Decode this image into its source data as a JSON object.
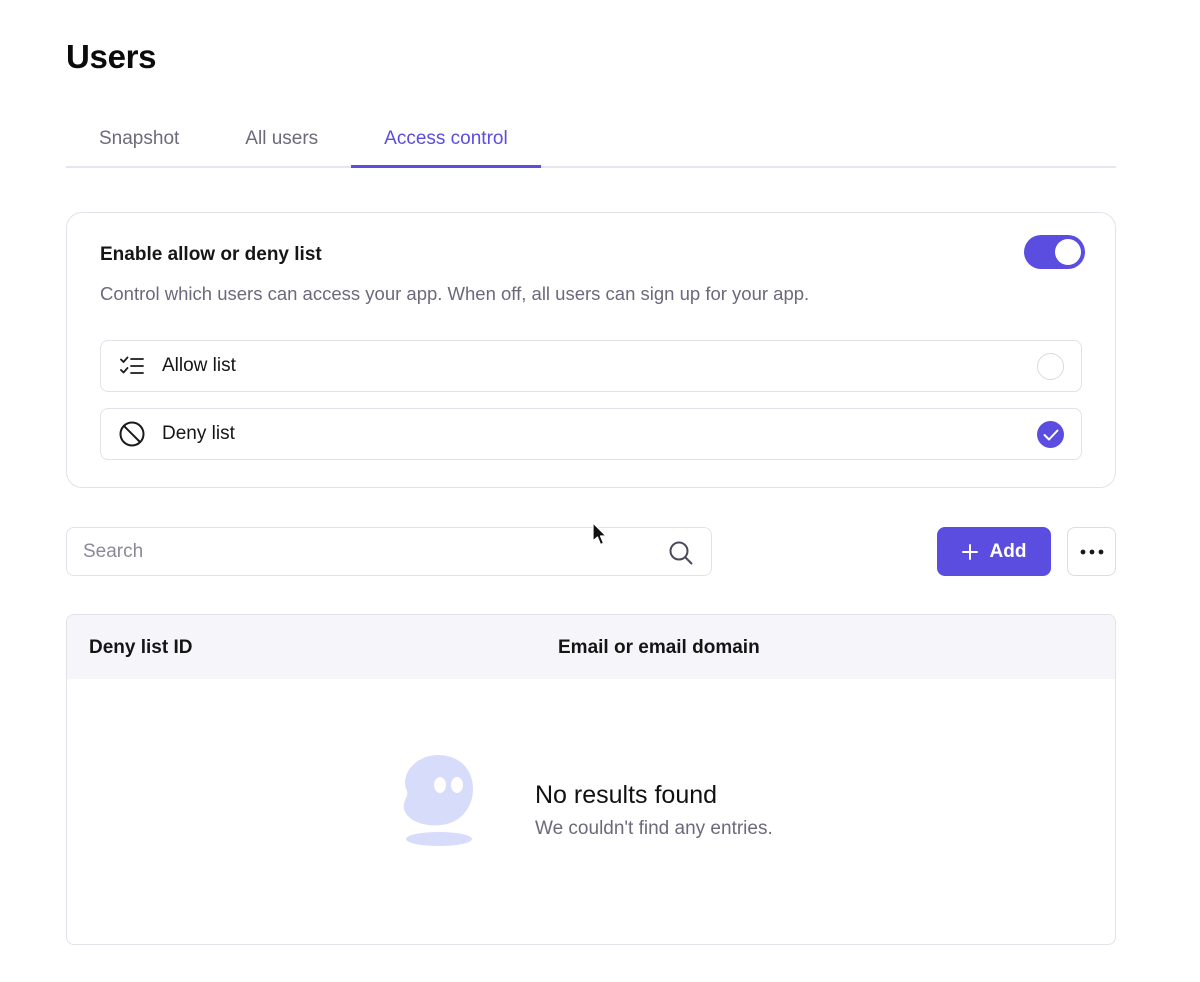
{
  "page": {
    "title": "Users"
  },
  "tabs": [
    {
      "label": "Snapshot",
      "active": false
    },
    {
      "label": "All users",
      "active": false
    },
    {
      "label": "Access control",
      "active": true
    }
  ],
  "access_card": {
    "title": "Enable allow or deny list",
    "description": "Control which users can access your app. When off, all users can sign up for your app.",
    "toggle_on": true,
    "options": [
      {
        "label": "Allow list",
        "icon": "checklist-icon",
        "selected": false
      },
      {
        "label": "Deny list",
        "icon": "block-icon",
        "selected": true
      }
    ]
  },
  "toolbar": {
    "search_placeholder": "Search",
    "add_label": "Add"
  },
  "table": {
    "columns": [
      "Deny list ID",
      "Email or email domain"
    ],
    "empty_title": "No results found",
    "empty_subtitle": "We couldn't find any entries."
  },
  "colors": {
    "accent": "#5b4de0",
    "muted_text": "#6a6a7c",
    "border": "#e2e2ea",
    "illustration": "#d8dcfb"
  }
}
